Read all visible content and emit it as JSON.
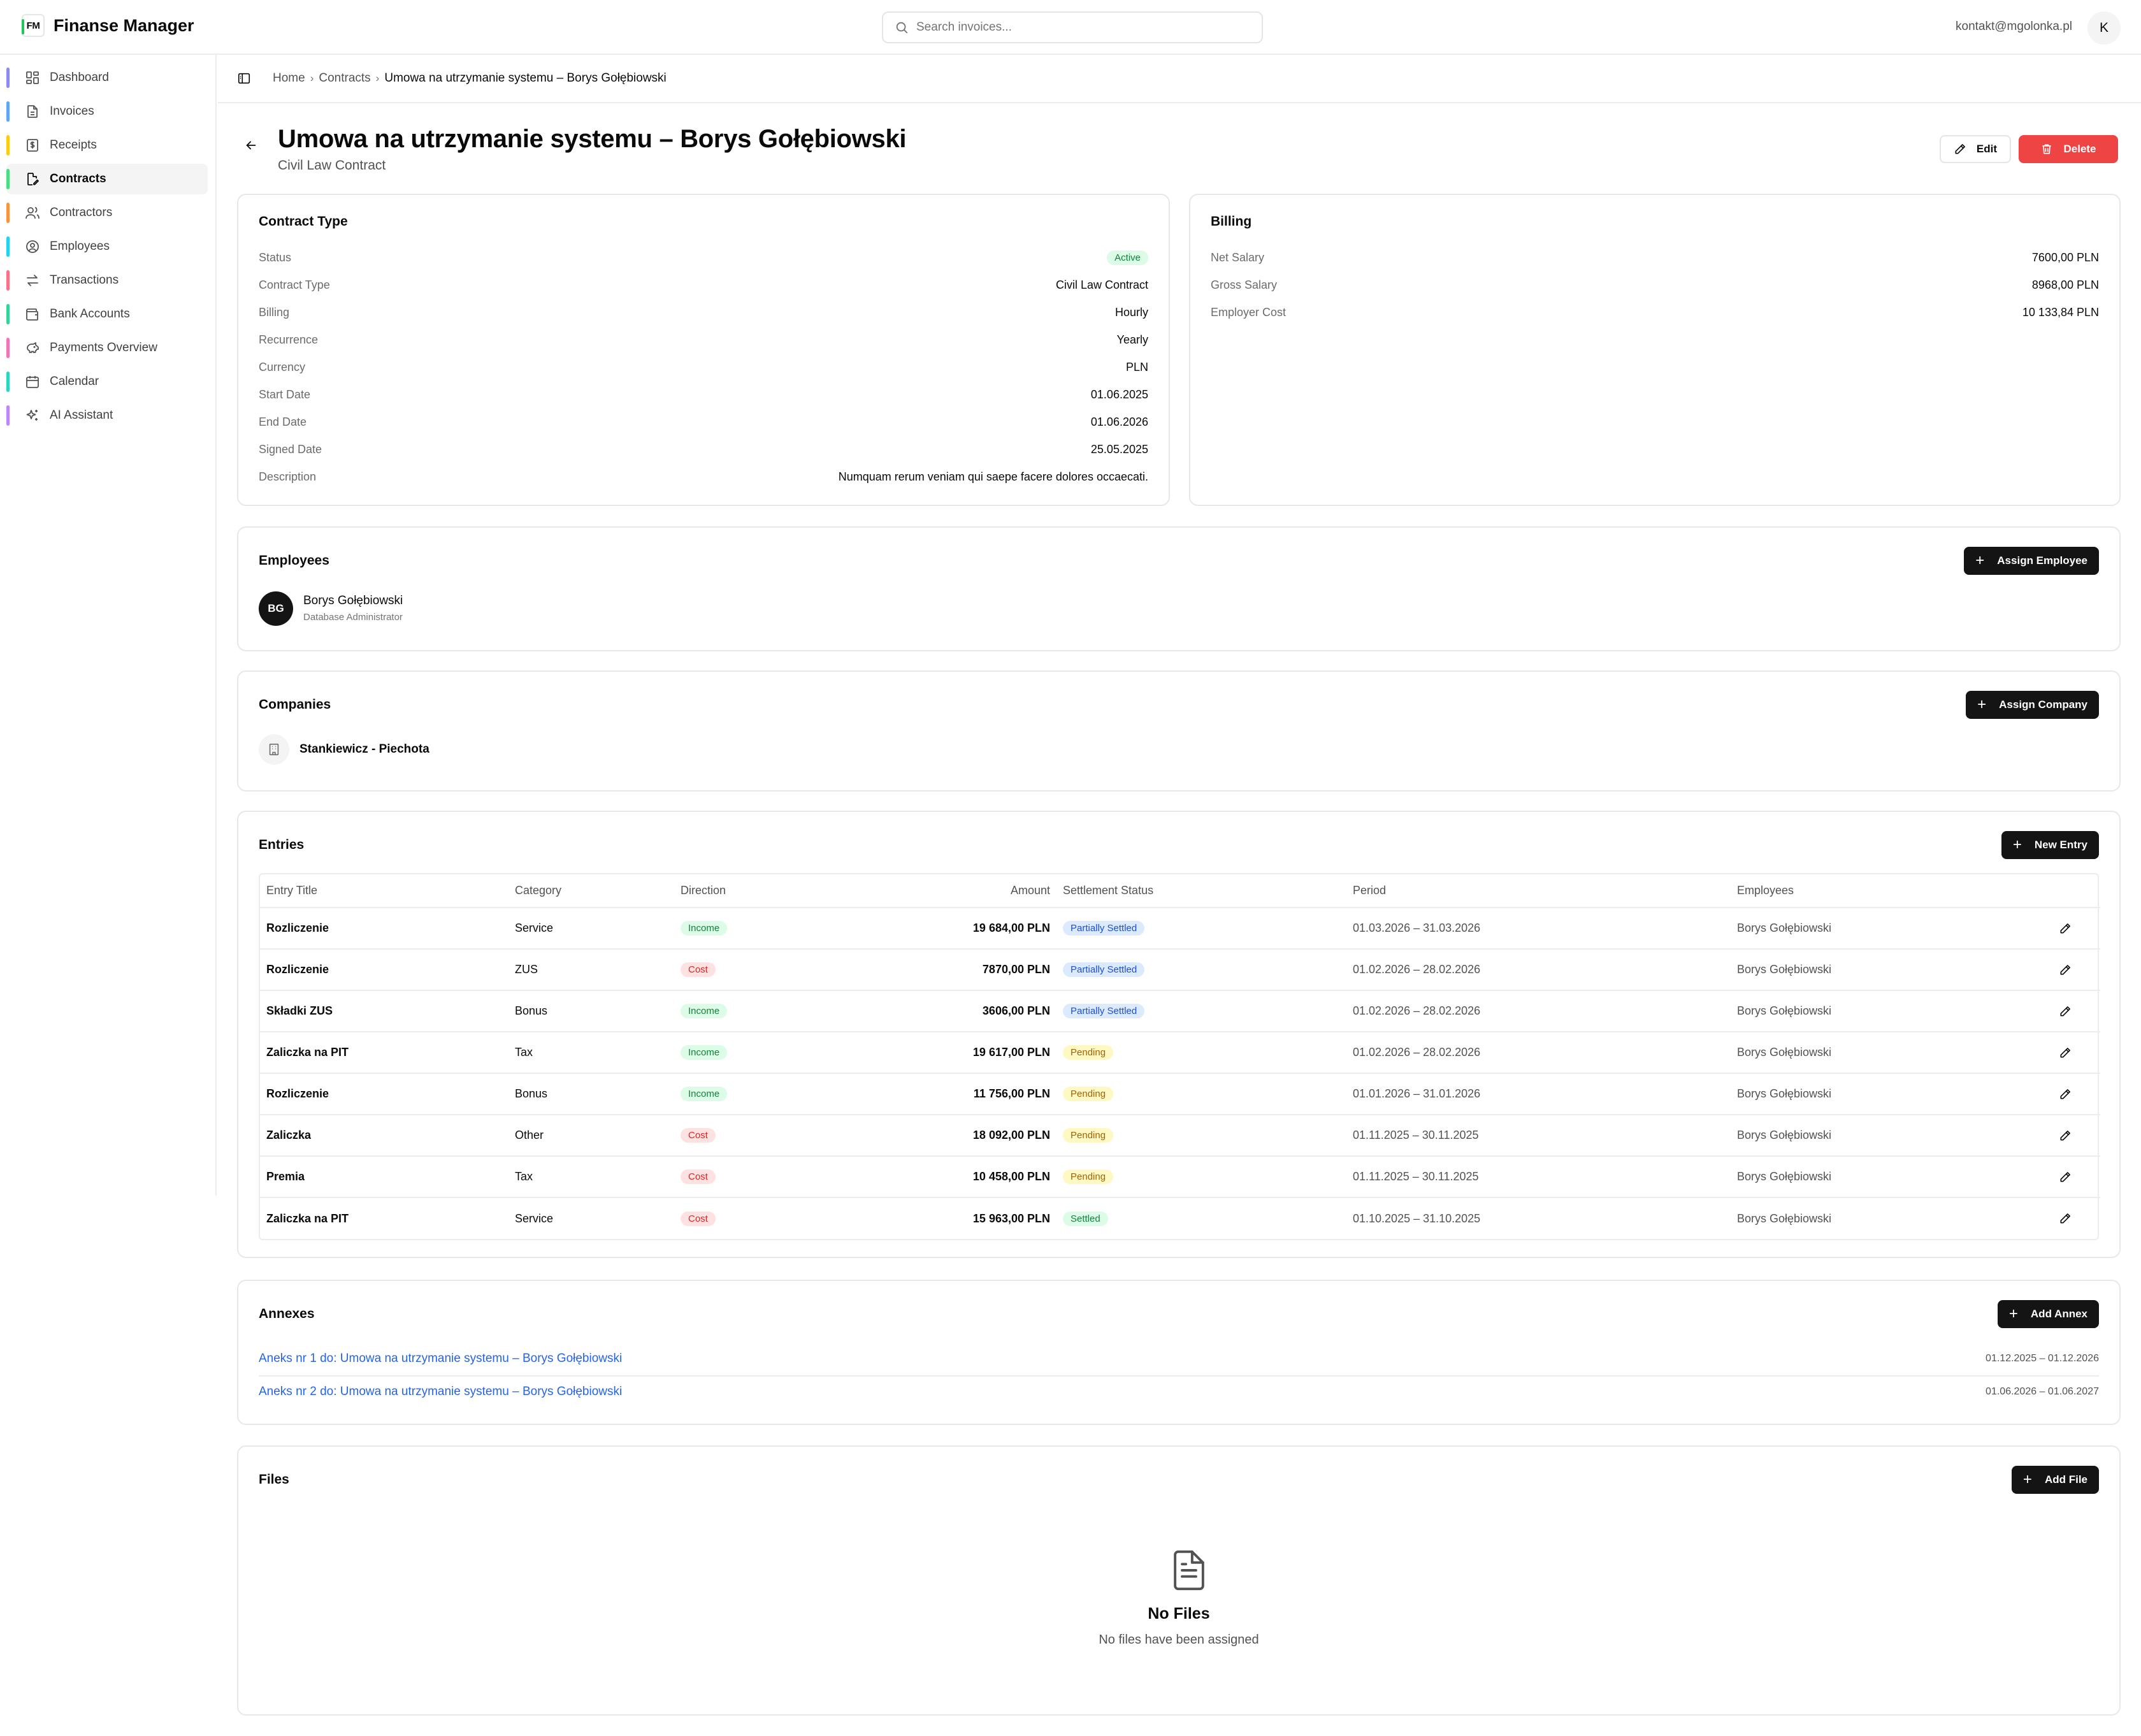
{
  "app": {
    "logo": "FM",
    "name": "Finanse Manager"
  },
  "search": {
    "placeholder": "Search invoices..."
  },
  "user": {
    "email": "kontakt@mgolonka.pl",
    "initial": "K"
  },
  "sidebar": {
    "items": [
      {
        "label": "Dashboard",
        "icon": "dashboard-icon",
        "accent": "#8b8bf5"
      },
      {
        "label": "Invoices",
        "icon": "invoice-icon",
        "accent": "#60a5fa"
      },
      {
        "label": "Receipts",
        "icon": "receipt-icon",
        "accent": "#facc15"
      },
      {
        "label": "Contracts",
        "icon": "contract-icon",
        "accent": "#4ade80",
        "active": true
      },
      {
        "label": "Contractors",
        "icon": "contractors-icon",
        "accent": "#fb923c"
      },
      {
        "label": "Employees",
        "icon": "employees-icon",
        "accent": "#22d3ee"
      },
      {
        "label": "Transactions",
        "icon": "transactions-icon",
        "accent": "#fb7185"
      },
      {
        "label": "Bank Accounts",
        "icon": "bank-icon",
        "accent": "#34d399"
      },
      {
        "label": "Payments Overview",
        "icon": "piggy-bank-icon",
        "accent": "#f472b6"
      },
      {
        "label": "Calendar",
        "icon": "calendar-icon",
        "accent": "#2dd4bf"
      },
      {
        "label": "AI Assistant",
        "icon": "sparkles-icon",
        "accent": "#c084fc"
      }
    ]
  },
  "breadcrumb": {
    "home": "Home",
    "contracts": "Contracts",
    "current": "Umowa na utrzymanie systemu – Borys Gołębiowski"
  },
  "header": {
    "title": "Umowa na utrzymanie systemu – Borys Gołębiowski",
    "subtitle": "Civil Law Contract",
    "edit_label": "Edit",
    "delete_label": "Delete"
  },
  "contract_card": {
    "title": "Contract Type",
    "rows": [
      {
        "label": "Status",
        "value": "Active",
        "badge": "green"
      },
      {
        "label": "Contract Type",
        "value": "Civil Law Contract"
      },
      {
        "label": "Billing",
        "value": "Hourly"
      },
      {
        "label": "Recurrence",
        "value": "Yearly"
      },
      {
        "label": "Currency",
        "value": "PLN"
      },
      {
        "label": "Start Date",
        "value": "01.06.2025"
      },
      {
        "label": "End Date",
        "value": "01.06.2026"
      },
      {
        "label": "Signed Date",
        "value": "25.05.2025"
      },
      {
        "label": "Description",
        "value": "Numquam rerum veniam qui saepe facere dolores occaecati."
      }
    ]
  },
  "billing_card": {
    "title": "Billing",
    "rows": [
      {
        "label": "Net Salary",
        "value": "7600,00 PLN"
      },
      {
        "label": "Gross Salary",
        "value": "8968,00 PLN"
      },
      {
        "label": "Employer Cost",
        "value": "10 133,84 PLN"
      }
    ]
  },
  "employees_card": {
    "title": "Employees",
    "button": "Assign Employee",
    "employee": {
      "initials": "BG",
      "name": "Borys Gołębiowski",
      "role": "Database Administrator"
    }
  },
  "companies_card": {
    "title": "Companies",
    "button": "Assign Company",
    "company": "Stankiewicz - Piechota"
  },
  "entries_card": {
    "title": "Entries",
    "button": "New Entry",
    "columns": [
      "Entry Title",
      "Category",
      "Direction",
      "Amount",
      "Settlement Status",
      "Period",
      "Employees"
    ],
    "rows": [
      {
        "title": "Rozliczenie",
        "category": "Service",
        "direction": "Income",
        "amount": "19 684,00 PLN",
        "status": "Partially Settled",
        "period": "01.03.2026 – 31.03.2026",
        "employee": "Borys Gołębiowski"
      },
      {
        "title": "Rozliczenie",
        "category": "ZUS",
        "direction": "Cost",
        "amount": "7870,00 PLN",
        "status": "Partially Settled",
        "period": "01.02.2026 – 28.02.2026",
        "employee": "Borys Gołębiowski"
      },
      {
        "title": "Składki ZUS",
        "category": "Bonus",
        "direction": "Income",
        "amount": "3606,00 PLN",
        "status": "Partially Settled",
        "period": "01.02.2026 – 28.02.2026",
        "employee": "Borys Gołębiowski"
      },
      {
        "title": "Zaliczka na PIT",
        "category": "Tax",
        "direction": "Income",
        "amount": "19 617,00 PLN",
        "status": "Pending",
        "period": "01.02.2026 – 28.02.2026",
        "employee": "Borys Gołębiowski"
      },
      {
        "title": "Rozliczenie",
        "category": "Bonus",
        "direction": "Income",
        "amount": "11 756,00 PLN",
        "status": "Pending",
        "period": "01.01.2026 – 31.01.2026",
        "employee": "Borys Gołębiowski"
      },
      {
        "title": "Zaliczka",
        "category": "Other",
        "direction": "Cost",
        "amount": "18 092,00 PLN",
        "status": "Pending",
        "period": "01.11.2025 – 30.11.2025",
        "employee": "Borys Gołębiowski"
      },
      {
        "title": "Premia",
        "category": "Tax",
        "direction": "Cost",
        "amount": "10 458,00 PLN",
        "status": "Pending",
        "period": "01.11.2025 – 30.11.2025",
        "employee": "Borys Gołębiowski"
      },
      {
        "title": "Zaliczka na PIT",
        "category": "Service",
        "direction": "Cost",
        "amount": "15 963,00 PLN",
        "status": "Settled",
        "period": "01.10.2025 – 31.10.2025",
        "employee": "Borys Gołębiowski"
      }
    ]
  },
  "annexes_card": {
    "title": "Annexes",
    "button": "Add Annex",
    "items": [
      {
        "label": "Aneks nr 1 do: Umowa na utrzymanie systemu – Borys Gołębiowski",
        "period": "01.12.2025 – 01.12.2026"
      },
      {
        "label": "Aneks nr 2 do: Umowa na utrzymanie systemu – Borys Gołębiowski",
        "period": "01.06.2026 – 01.06.2027"
      }
    ]
  },
  "files_card": {
    "title": "Files",
    "button": "Add File",
    "empty_title": "No Files",
    "empty_sub": "No files have been assigned"
  }
}
